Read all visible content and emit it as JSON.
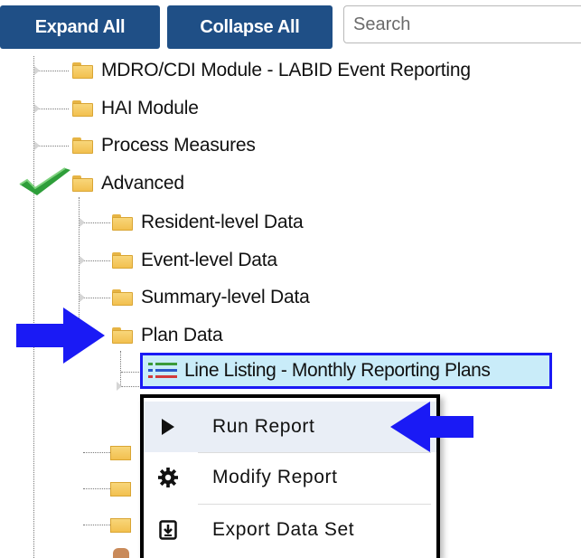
{
  "toolbar": {
    "expand_all_label": "Expand All",
    "collapse_all_label": "Collapse All",
    "search_placeholder": "Search"
  },
  "tree": {
    "top_items": [
      {
        "label": "MDRO/CDI Module - LABID Event Reporting"
      },
      {
        "label": "HAI Module"
      },
      {
        "label": "Process Measures"
      },
      {
        "label": "Advanced"
      }
    ],
    "advanced_children": [
      {
        "label": "Resident-level Data"
      },
      {
        "label": "Event-level Data"
      },
      {
        "label": "Summary-level Data"
      },
      {
        "label": "Plan Data"
      }
    ],
    "selected_report": {
      "label": "Line Listing - Monthly Reporting Plans"
    }
  },
  "context_menu": {
    "items": [
      {
        "label": "Run Report",
        "icon": "play-icon"
      },
      {
        "label": "Modify Report",
        "icon": "gear-icon"
      },
      {
        "label": "Export Data Set",
        "icon": "export-icon"
      }
    ]
  },
  "colors": {
    "button_bg": "#1f4f86",
    "highlight_bg": "#c9ecf9",
    "selection_border": "#1a1af5",
    "callout_arrow": "#1a1af5",
    "checkmark": "#2e9e3a",
    "folder": "#f2c04f"
  }
}
